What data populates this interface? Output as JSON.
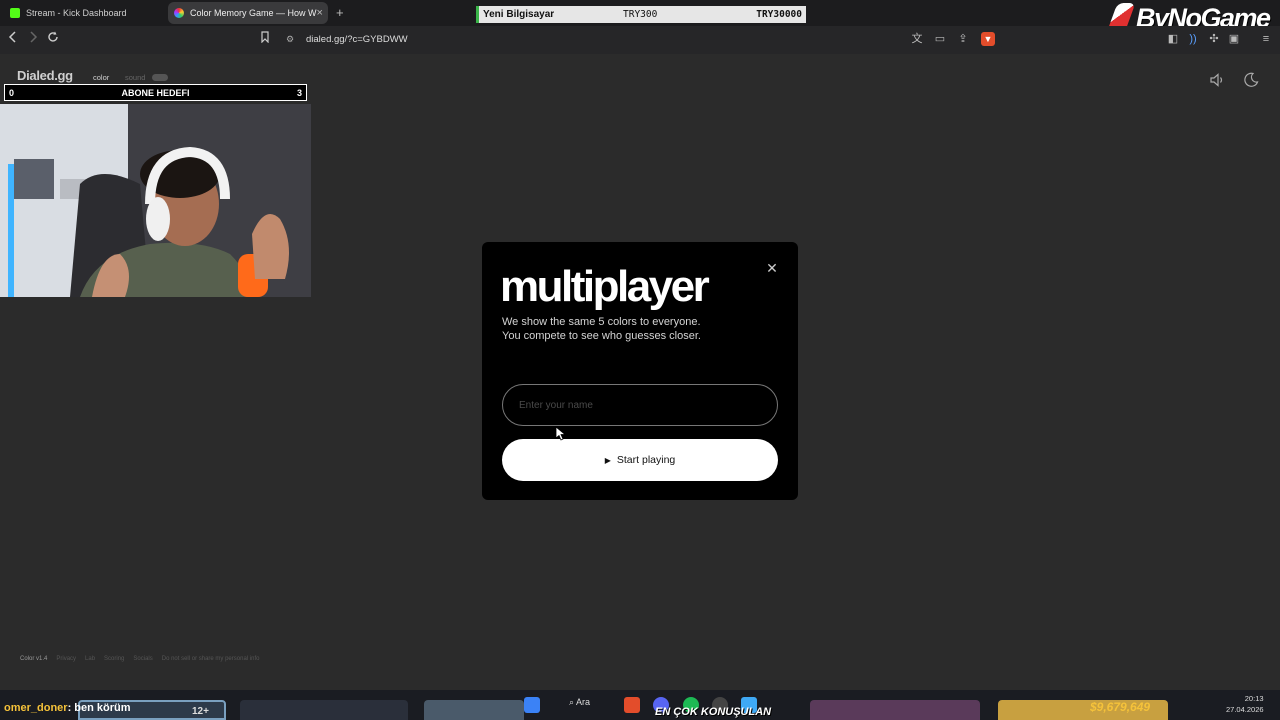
{
  "tabs": [
    {
      "label": "Stream - Kick Dashboard",
      "icon": "kick-icon"
    },
    {
      "label": "Color Memory Game — How W",
      "icon": "dialed-icon"
    }
  ],
  "donation_bar": {
    "label": "Yeni Bilgisayar",
    "current": "TRY300",
    "goal": "TRY30000",
    "accent": "#3bb54a"
  },
  "logo_text": "ByNoGame",
  "address": {
    "url": "dialed.gg/?c=GYBDWW"
  },
  "site": {
    "brand": "Dialed.gg",
    "mode_color": "color",
    "mode_sound": "sound"
  },
  "sub_goal": {
    "left": "0",
    "label": "ABONE HEDEFI",
    "right": "3"
  },
  "modal": {
    "title": "multiplayer",
    "line1": "We show the same 5 colors to everyone.",
    "line2": "You compete to see who guesses closer.",
    "name_placeholder": "Enter your name",
    "name_value": "",
    "start_label": "Start playing"
  },
  "footer": [
    "Color v1.4",
    "Privacy",
    "Lab",
    "Scoring",
    "Socials",
    "Do not sell or share my personal info"
  ],
  "taskbar": {
    "chat_user": "omer_doner",
    "chat_text": ": ben körüm",
    "badge": "12+",
    "search_label": "Ara",
    "popular_banner": "EN ÇOK KONUŞULAN",
    "amount_text": "$9,679,649",
    "time": "20:13",
    "date": "27.04.2026"
  },
  "colors": {
    "page_bg": "#2b2b2b",
    "modal_bg": "#000000",
    "button_bg": "#ffffff",
    "kick_green": "#53fc18"
  }
}
